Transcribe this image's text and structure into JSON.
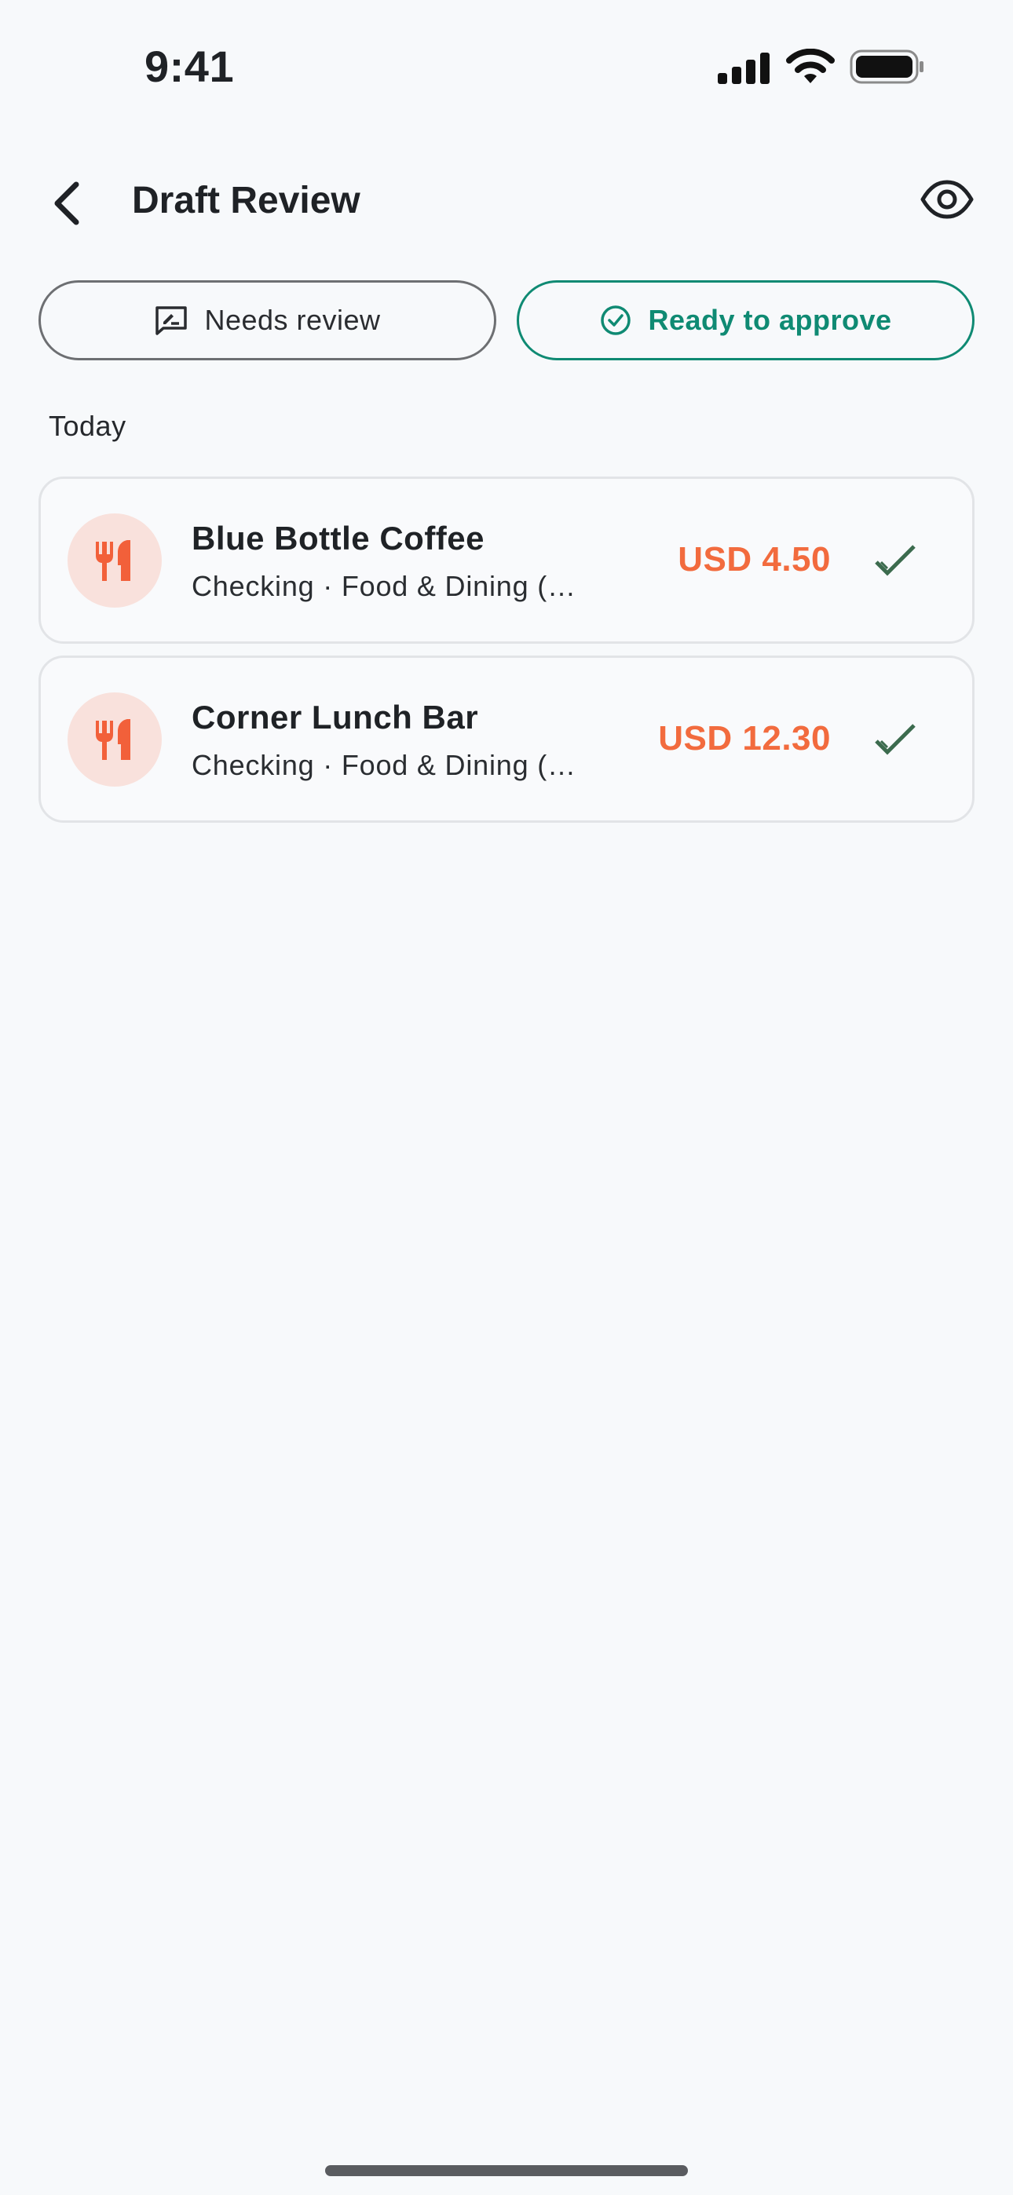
{
  "status_bar": {
    "time": "9:41"
  },
  "header": {
    "title": "Draft Review"
  },
  "filters": [
    {
      "label": "Needs review",
      "icon": "review-message-icon"
    },
    {
      "label": "Ready to approve",
      "icon": "check-circle-icon"
    }
  ],
  "section": {
    "label": "Today"
  },
  "transactions": [
    {
      "name": "Blue Bottle Coffee",
      "subtitle": "Checking · Food & Dining (…",
      "amount": "USD 4.50",
      "icon": "fork-knife-icon"
    },
    {
      "name": "Corner Lunch Bar",
      "subtitle": "Checking · Food & Dining (…",
      "amount": "USD 12.30",
      "icon": "fork-knife-icon"
    }
  ],
  "colors": {
    "accent": "#0f8a73",
    "amount": "#f26b3e",
    "icon_bg": "#f9e1dc",
    "check": "#3c6b4e"
  }
}
